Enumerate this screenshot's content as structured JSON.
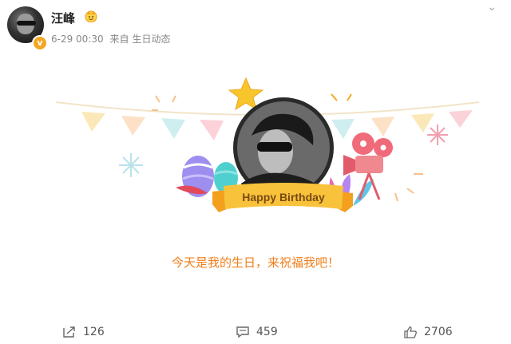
{
  "post": {
    "author": "汪峰",
    "timestamp": "6-29 00:30",
    "source_prefix": "来自",
    "source": "生日动态",
    "caption": "今天是我的生日，来祝福我吧！"
  },
  "banner": {
    "ribbon_text": "Happy Birthday"
  },
  "actions": {
    "share_count": "126",
    "comment_count": "459",
    "like_count": "2706"
  },
  "colors": {
    "caption": "#f07f1a",
    "ribbon": "#f8c23a",
    "verified": "#f3a623",
    "star": "#f7c52c"
  },
  "icons": {
    "verified": "verified-v-icon",
    "badge": "crown-badge-icon",
    "share": "share-icon",
    "comment": "comment-icon",
    "like": "thumbs-up-icon",
    "more": "chevron-down-icon"
  }
}
